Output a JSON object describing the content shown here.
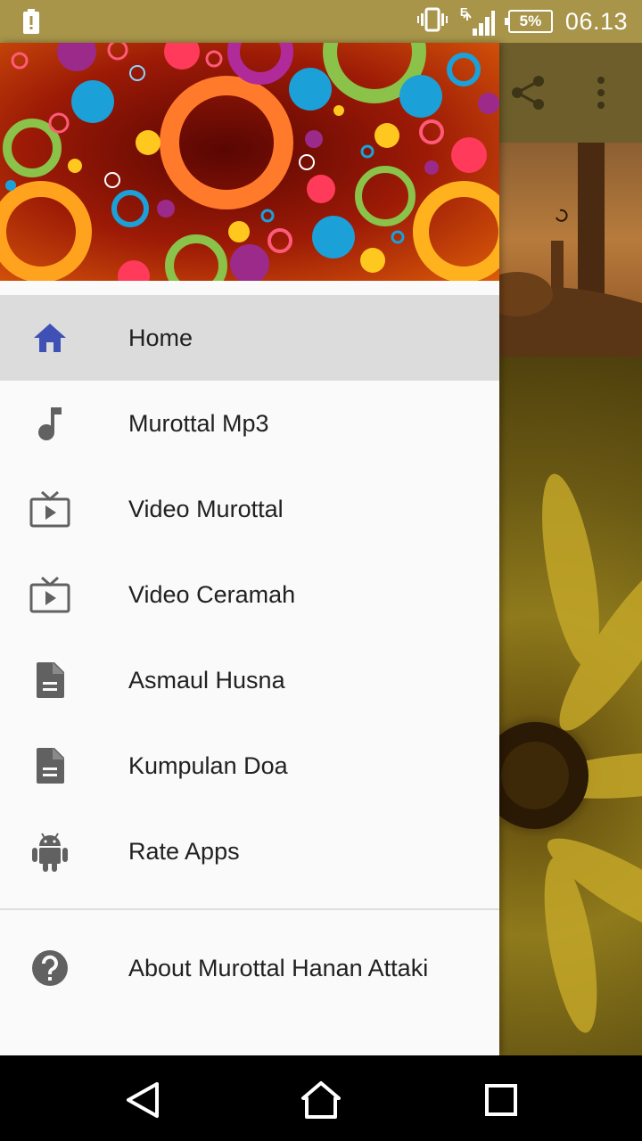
{
  "status_bar": {
    "battery_percent": "5%",
    "time": "06.13",
    "network": "E"
  },
  "drawer": {
    "menu_items": [
      {
        "label": "Home",
        "icon": "home-icon",
        "active": true
      },
      {
        "label": "Murottal Mp3",
        "icon": "music-note-icon",
        "active": false
      },
      {
        "label": "Video Murottal",
        "icon": "tv-icon",
        "active": false
      },
      {
        "label": "Video Ceramah",
        "icon": "tv-icon",
        "active": false
      },
      {
        "label": "Asmaul Husna",
        "icon": "document-icon",
        "active": false
      },
      {
        "label": "Kumpulan Doa",
        "icon": "document-icon",
        "active": false
      },
      {
        "label": "Rate Apps",
        "icon": "android-icon",
        "active": false
      }
    ],
    "footer_item": {
      "label": "About Murottal Hanan Attaki",
      "icon": "help-icon"
    }
  },
  "colors": {
    "status_bar": "#a8954a",
    "home_icon_accent": "#3f51b5",
    "icon_gray": "#616161"
  }
}
